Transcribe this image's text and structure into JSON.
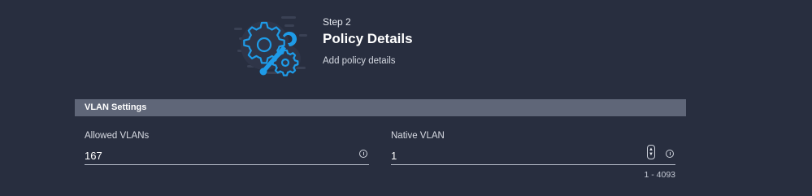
{
  "step": {
    "label": "Step 2",
    "title": "Policy Details",
    "subtitle": "Add policy details",
    "illustration_icon": "gear-wrench-icon"
  },
  "section": {
    "title": "VLAN Settings"
  },
  "fields": {
    "allowed_vlans": {
      "label": "Allowed VLANs",
      "value": "167",
      "info_icon": "info-icon"
    },
    "native_vlan": {
      "label": "Native VLAN",
      "value": "1",
      "range_hint": "1 - 4093",
      "stepper_icon": "stepper-icon",
      "info_icon": "info-icon"
    }
  },
  "colors": {
    "background": "#282e3f",
    "section_bar": "#5f6678",
    "accent_blue": "#1e9be8",
    "underline": "#b9bfcc"
  }
}
